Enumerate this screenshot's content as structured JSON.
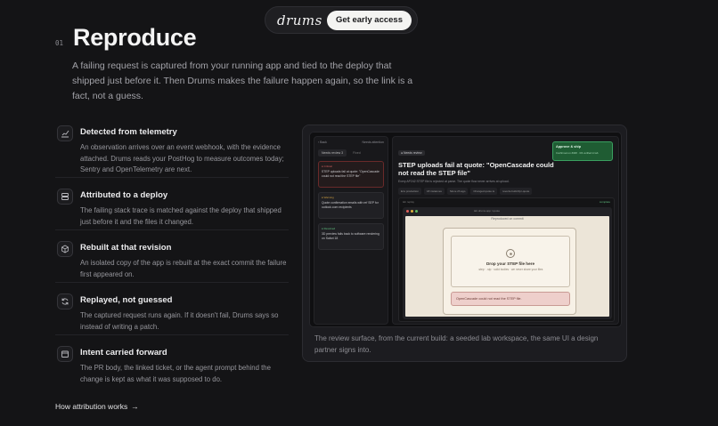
{
  "nav": {
    "logo": "drums",
    "cta_label": "Get early access"
  },
  "section": {
    "number": "01",
    "title": "Reproduce",
    "intro": "A failing request is captured from your running app and tied to the deploy that shipped just before it. Then Drums makes the failure happen again, so the link is a fact, not a guess."
  },
  "features": [
    {
      "icon": "telemetry-chart-icon",
      "title": "Detected from telemetry",
      "desc": "An observation arrives over an event webhook, with the evidence attached. Drums reads your PostHog to measure outcomes today; Sentry and OpenTelemetry are next."
    },
    {
      "icon": "server-stack-icon",
      "title": "Attributed to a deploy",
      "desc": "The failing stack trace is matched against the deploy that shipped just before it and the files it changed."
    },
    {
      "icon": "package-box-icon",
      "title": "Rebuilt at that revision",
      "desc": "An isolated copy of the app is rebuilt at the exact commit the failure first appeared on."
    },
    {
      "icon": "refresh-icon",
      "title": "Replayed, not guessed",
      "desc": "The captured request runs again. If it doesn't fail, Drums says so instead of writing a patch."
    },
    {
      "icon": "calendar-ticket-icon",
      "title": "Intent carried forward",
      "desc": "The PR body, the linked ticket, or the agent prompt behind the change is kept as what it was supposed to do."
    }
  ],
  "link": {
    "label": "How attribution works",
    "arrow": "→"
  },
  "preview": {
    "caption": "The review surface, from the current build: a seeded lab workspace, the same UI a design partner signs into.",
    "sidebar": {
      "back": "‹ Back",
      "meta": "Needs attention",
      "tabs": [
        "Needs review 3",
        "Fixed"
      ],
      "items": [
        {
          "tag": "● Critical",
          "tag_color": "red",
          "text": "STEP uploads fail at quote: \"OpenCascade could not read the STEP file\""
        },
        {
          "tag": "● Warning",
          "tag_color": "amber",
          "text": "Quote confirmation emails with ref SEP for outlook.com recipients"
        },
        {
          "tag": "● Resolved",
          "tag_color": "green",
          "text": "3D preview fails back to software rendering on Safari 18"
        }
      ]
    },
    "main": {
      "badge": "● Needs review",
      "title": "STEP uploads fail at quote: \"OpenCascade could not read the STEP file\"",
      "sub": "Every AP242 STEP file is rejected at parse. The quote flow never arrives at upload.",
      "chips": [
        "Env production",
        "18 instances",
        "Since 2h ago",
        "Changed quote.ts",
        "reverts-build #pr-quote"
      ],
      "approve_title": "Approve & ship",
      "approve_sub": "Confirmed on #348 · 3/3 verified in lab",
      "sub_window_label": "lab replay",
      "sub_window_status": "complete",
      "url": "lab.drums.app / quote",
      "page_head": "Reproduced on commit",
      "drop_title": "Drop your STEP file here",
      "drop_sub": ".step · .stp · solid bodies · we never share your files",
      "error_text": "OpenCascade could not read the STEP file."
    }
  }
}
